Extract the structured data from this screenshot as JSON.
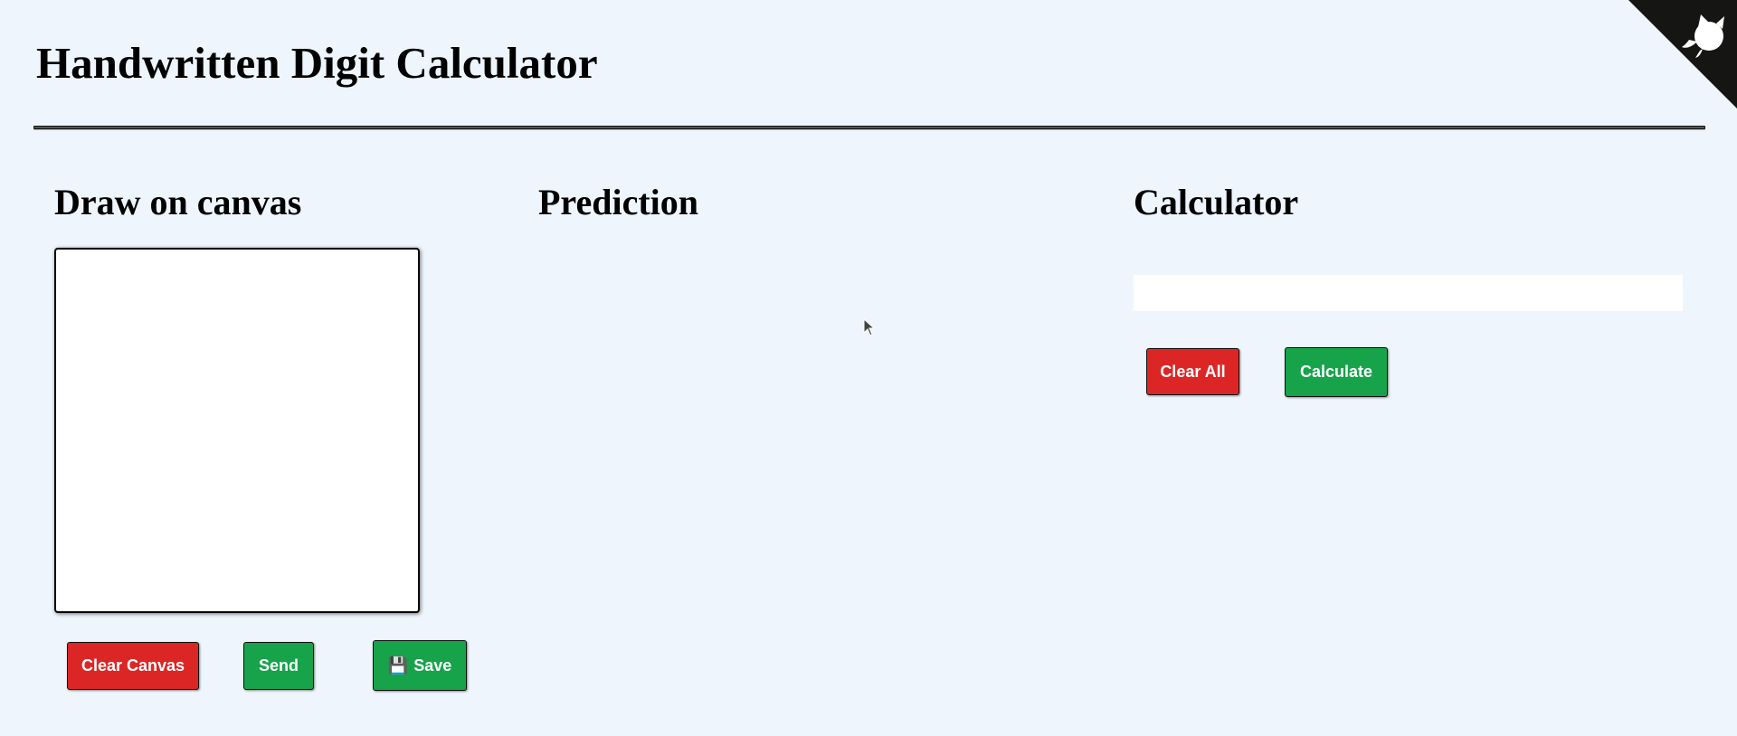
{
  "header": {
    "title": "Handwritten Digit Calculator"
  },
  "draw_section": {
    "title": "Draw on canvas",
    "buttons": {
      "clear_canvas": "Clear Canvas",
      "send": "Send",
      "save": "Save",
      "save_icon": "💾"
    }
  },
  "prediction_section": {
    "title": "Prediction"
  },
  "calculator_section": {
    "title": "Calculator",
    "display_value": "",
    "buttons": {
      "clear_all": "Clear All",
      "calculate": "Calculate"
    }
  },
  "icons": {
    "corner_banner": "github-cat-icon",
    "pointer": "mouse-cursor-icon",
    "save": "floppy-disk-icon"
  },
  "colors": {
    "background": "#eef5fd",
    "danger_button": "#dc2626",
    "success_button": "#16a34a",
    "corner_banner": "#151513"
  }
}
